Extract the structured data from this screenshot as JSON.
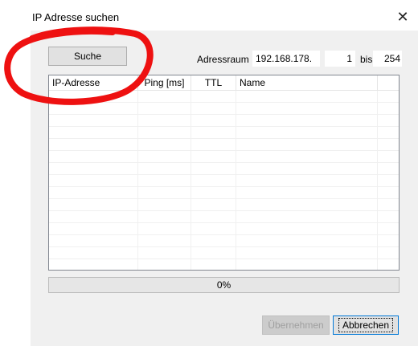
{
  "window": {
    "title": "IP Adresse suchen",
    "close_symbol": "✕"
  },
  "search": {
    "button_label": "Suche"
  },
  "address_range": {
    "label": "Adressraum",
    "ip_prefix": "192.168.178.",
    "start_octet": "1",
    "to_label": "bis",
    "end_octet": "254"
  },
  "table": {
    "columns": [
      "IP-Adresse",
      "Ping [ms]",
      "TTL",
      "Name"
    ],
    "rows": []
  },
  "progress": {
    "value": 0,
    "text": "0%"
  },
  "footer": {
    "apply_label": "Übernehmen",
    "cancel_label": "Abbrechen"
  },
  "colors": {
    "annotation_red": "#ee1111",
    "focus_blue": "#0078d7"
  }
}
